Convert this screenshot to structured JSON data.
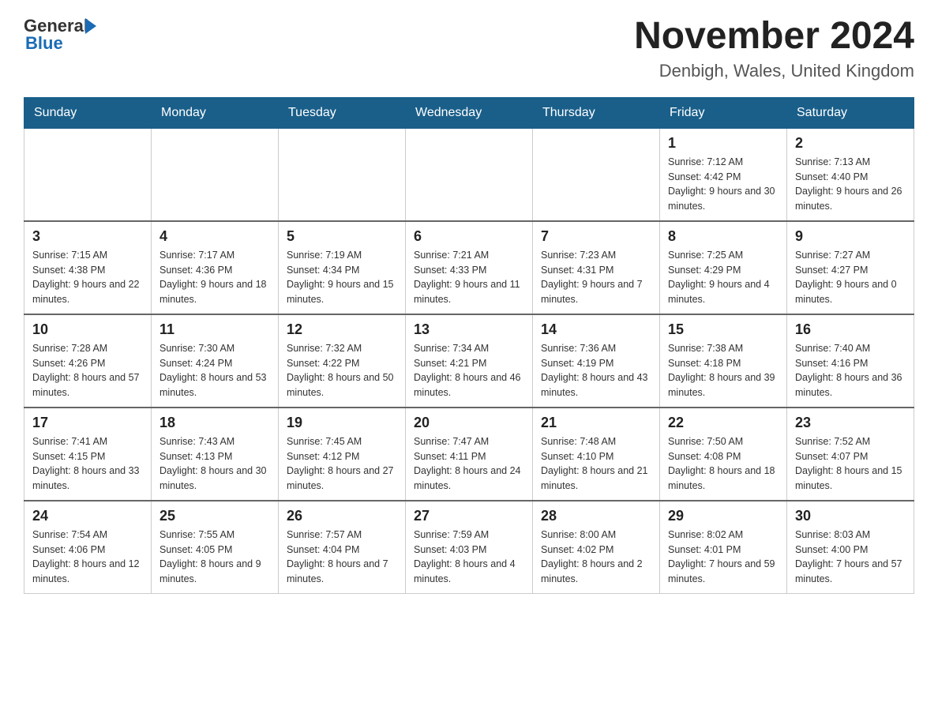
{
  "logo": {
    "text_general": "General",
    "text_blue": "Blue"
  },
  "title": "November 2024",
  "subtitle": "Denbigh, Wales, United Kingdom",
  "days_of_week": [
    "Sunday",
    "Monday",
    "Tuesday",
    "Wednesday",
    "Thursday",
    "Friday",
    "Saturday"
  ],
  "weeks": [
    [
      {
        "day": "",
        "sunrise": "",
        "sunset": "",
        "daylight": ""
      },
      {
        "day": "",
        "sunrise": "",
        "sunset": "",
        "daylight": ""
      },
      {
        "day": "",
        "sunrise": "",
        "sunset": "",
        "daylight": ""
      },
      {
        "day": "",
        "sunrise": "",
        "sunset": "",
        "daylight": ""
      },
      {
        "day": "",
        "sunrise": "",
        "sunset": "",
        "daylight": ""
      },
      {
        "day": "1",
        "sunrise": "Sunrise: 7:12 AM",
        "sunset": "Sunset: 4:42 PM",
        "daylight": "Daylight: 9 hours and 30 minutes."
      },
      {
        "day": "2",
        "sunrise": "Sunrise: 7:13 AM",
        "sunset": "Sunset: 4:40 PM",
        "daylight": "Daylight: 9 hours and 26 minutes."
      }
    ],
    [
      {
        "day": "3",
        "sunrise": "Sunrise: 7:15 AM",
        "sunset": "Sunset: 4:38 PM",
        "daylight": "Daylight: 9 hours and 22 minutes."
      },
      {
        "day": "4",
        "sunrise": "Sunrise: 7:17 AM",
        "sunset": "Sunset: 4:36 PM",
        "daylight": "Daylight: 9 hours and 18 minutes."
      },
      {
        "day": "5",
        "sunrise": "Sunrise: 7:19 AM",
        "sunset": "Sunset: 4:34 PM",
        "daylight": "Daylight: 9 hours and 15 minutes."
      },
      {
        "day": "6",
        "sunrise": "Sunrise: 7:21 AM",
        "sunset": "Sunset: 4:33 PM",
        "daylight": "Daylight: 9 hours and 11 minutes."
      },
      {
        "day": "7",
        "sunrise": "Sunrise: 7:23 AM",
        "sunset": "Sunset: 4:31 PM",
        "daylight": "Daylight: 9 hours and 7 minutes."
      },
      {
        "day": "8",
        "sunrise": "Sunrise: 7:25 AM",
        "sunset": "Sunset: 4:29 PM",
        "daylight": "Daylight: 9 hours and 4 minutes."
      },
      {
        "day": "9",
        "sunrise": "Sunrise: 7:27 AM",
        "sunset": "Sunset: 4:27 PM",
        "daylight": "Daylight: 9 hours and 0 minutes."
      }
    ],
    [
      {
        "day": "10",
        "sunrise": "Sunrise: 7:28 AM",
        "sunset": "Sunset: 4:26 PM",
        "daylight": "Daylight: 8 hours and 57 minutes."
      },
      {
        "day": "11",
        "sunrise": "Sunrise: 7:30 AM",
        "sunset": "Sunset: 4:24 PM",
        "daylight": "Daylight: 8 hours and 53 minutes."
      },
      {
        "day": "12",
        "sunrise": "Sunrise: 7:32 AM",
        "sunset": "Sunset: 4:22 PM",
        "daylight": "Daylight: 8 hours and 50 minutes."
      },
      {
        "day": "13",
        "sunrise": "Sunrise: 7:34 AM",
        "sunset": "Sunset: 4:21 PM",
        "daylight": "Daylight: 8 hours and 46 minutes."
      },
      {
        "day": "14",
        "sunrise": "Sunrise: 7:36 AM",
        "sunset": "Sunset: 4:19 PM",
        "daylight": "Daylight: 8 hours and 43 minutes."
      },
      {
        "day": "15",
        "sunrise": "Sunrise: 7:38 AM",
        "sunset": "Sunset: 4:18 PM",
        "daylight": "Daylight: 8 hours and 39 minutes."
      },
      {
        "day": "16",
        "sunrise": "Sunrise: 7:40 AM",
        "sunset": "Sunset: 4:16 PM",
        "daylight": "Daylight: 8 hours and 36 minutes."
      }
    ],
    [
      {
        "day": "17",
        "sunrise": "Sunrise: 7:41 AM",
        "sunset": "Sunset: 4:15 PM",
        "daylight": "Daylight: 8 hours and 33 minutes."
      },
      {
        "day": "18",
        "sunrise": "Sunrise: 7:43 AM",
        "sunset": "Sunset: 4:13 PM",
        "daylight": "Daylight: 8 hours and 30 minutes."
      },
      {
        "day": "19",
        "sunrise": "Sunrise: 7:45 AM",
        "sunset": "Sunset: 4:12 PM",
        "daylight": "Daylight: 8 hours and 27 minutes."
      },
      {
        "day": "20",
        "sunrise": "Sunrise: 7:47 AM",
        "sunset": "Sunset: 4:11 PM",
        "daylight": "Daylight: 8 hours and 24 minutes."
      },
      {
        "day": "21",
        "sunrise": "Sunrise: 7:48 AM",
        "sunset": "Sunset: 4:10 PM",
        "daylight": "Daylight: 8 hours and 21 minutes."
      },
      {
        "day": "22",
        "sunrise": "Sunrise: 7:50 AM",
        "sunset": "Sunset: 4:08 PM",
        "daylight": "Daylight: 8 hours and 18 minutes."
      },
      {
        "day": "23",
        "sunrise": "Sunrise: 7:52 AM",
        "sunset": "Sunset: 4:07 PM",
        "daylight": "Daylight: 8 hours and 15 minutes."
      }
    ],
    [
      {
        "day": "24",
        "sunrise": "Sunrise: 7:54 AM",
        "sunset": "Sunset: 4:06 PM",
        "daylight": "Daylight: 8 hours and 12 minutes."
      },
      {
        "day": "25",
        "sunrise": "Sunrise: 7:55 AM",
        "sunset": "Sunset: 4:05 PM",
        "daylight": "Daylight: 8 hours and 9 minutes."
      },
      {
        "day": "26",
        "sunrise": "Sunrise: 7:57 AM",
        "sunset": "Sunset: 4:04 PM",
        "daylight": "Daylight: 8 hours and 7 minutes."
      },
      {
        "day": "27",
        "sunrise": "Sunrise: 7:59 AM",
        "sunset": "Sunset: 4:03 PM",
        "daylight": "Daylight: 8 hours and 4 minutes."
      },
      {
        "day": "28",
        "sunrise": "Sunrise: 8:00 AM",
        "sunset": "Sunset: 4:02 PM",
        "daylight": "Daylight: 8 hours and 2 minutes."
      },
      {
        "day": "29",
        "sunrise": "Sunrise: 8:02 AM",
        "sunset": "Sunset: 4:01 PM",
        "daylight": "Daylight: 7 hours and 59 minutes."
      },
      {
        "day": "30",
        "sunrise": "Sunrise: 8:03 AM",
        "sunset": "Sunset: 4:00 PM",
        "daylight": "Daylight: 7 hours and 57 minutes."
      }
    ]
  ]
}
